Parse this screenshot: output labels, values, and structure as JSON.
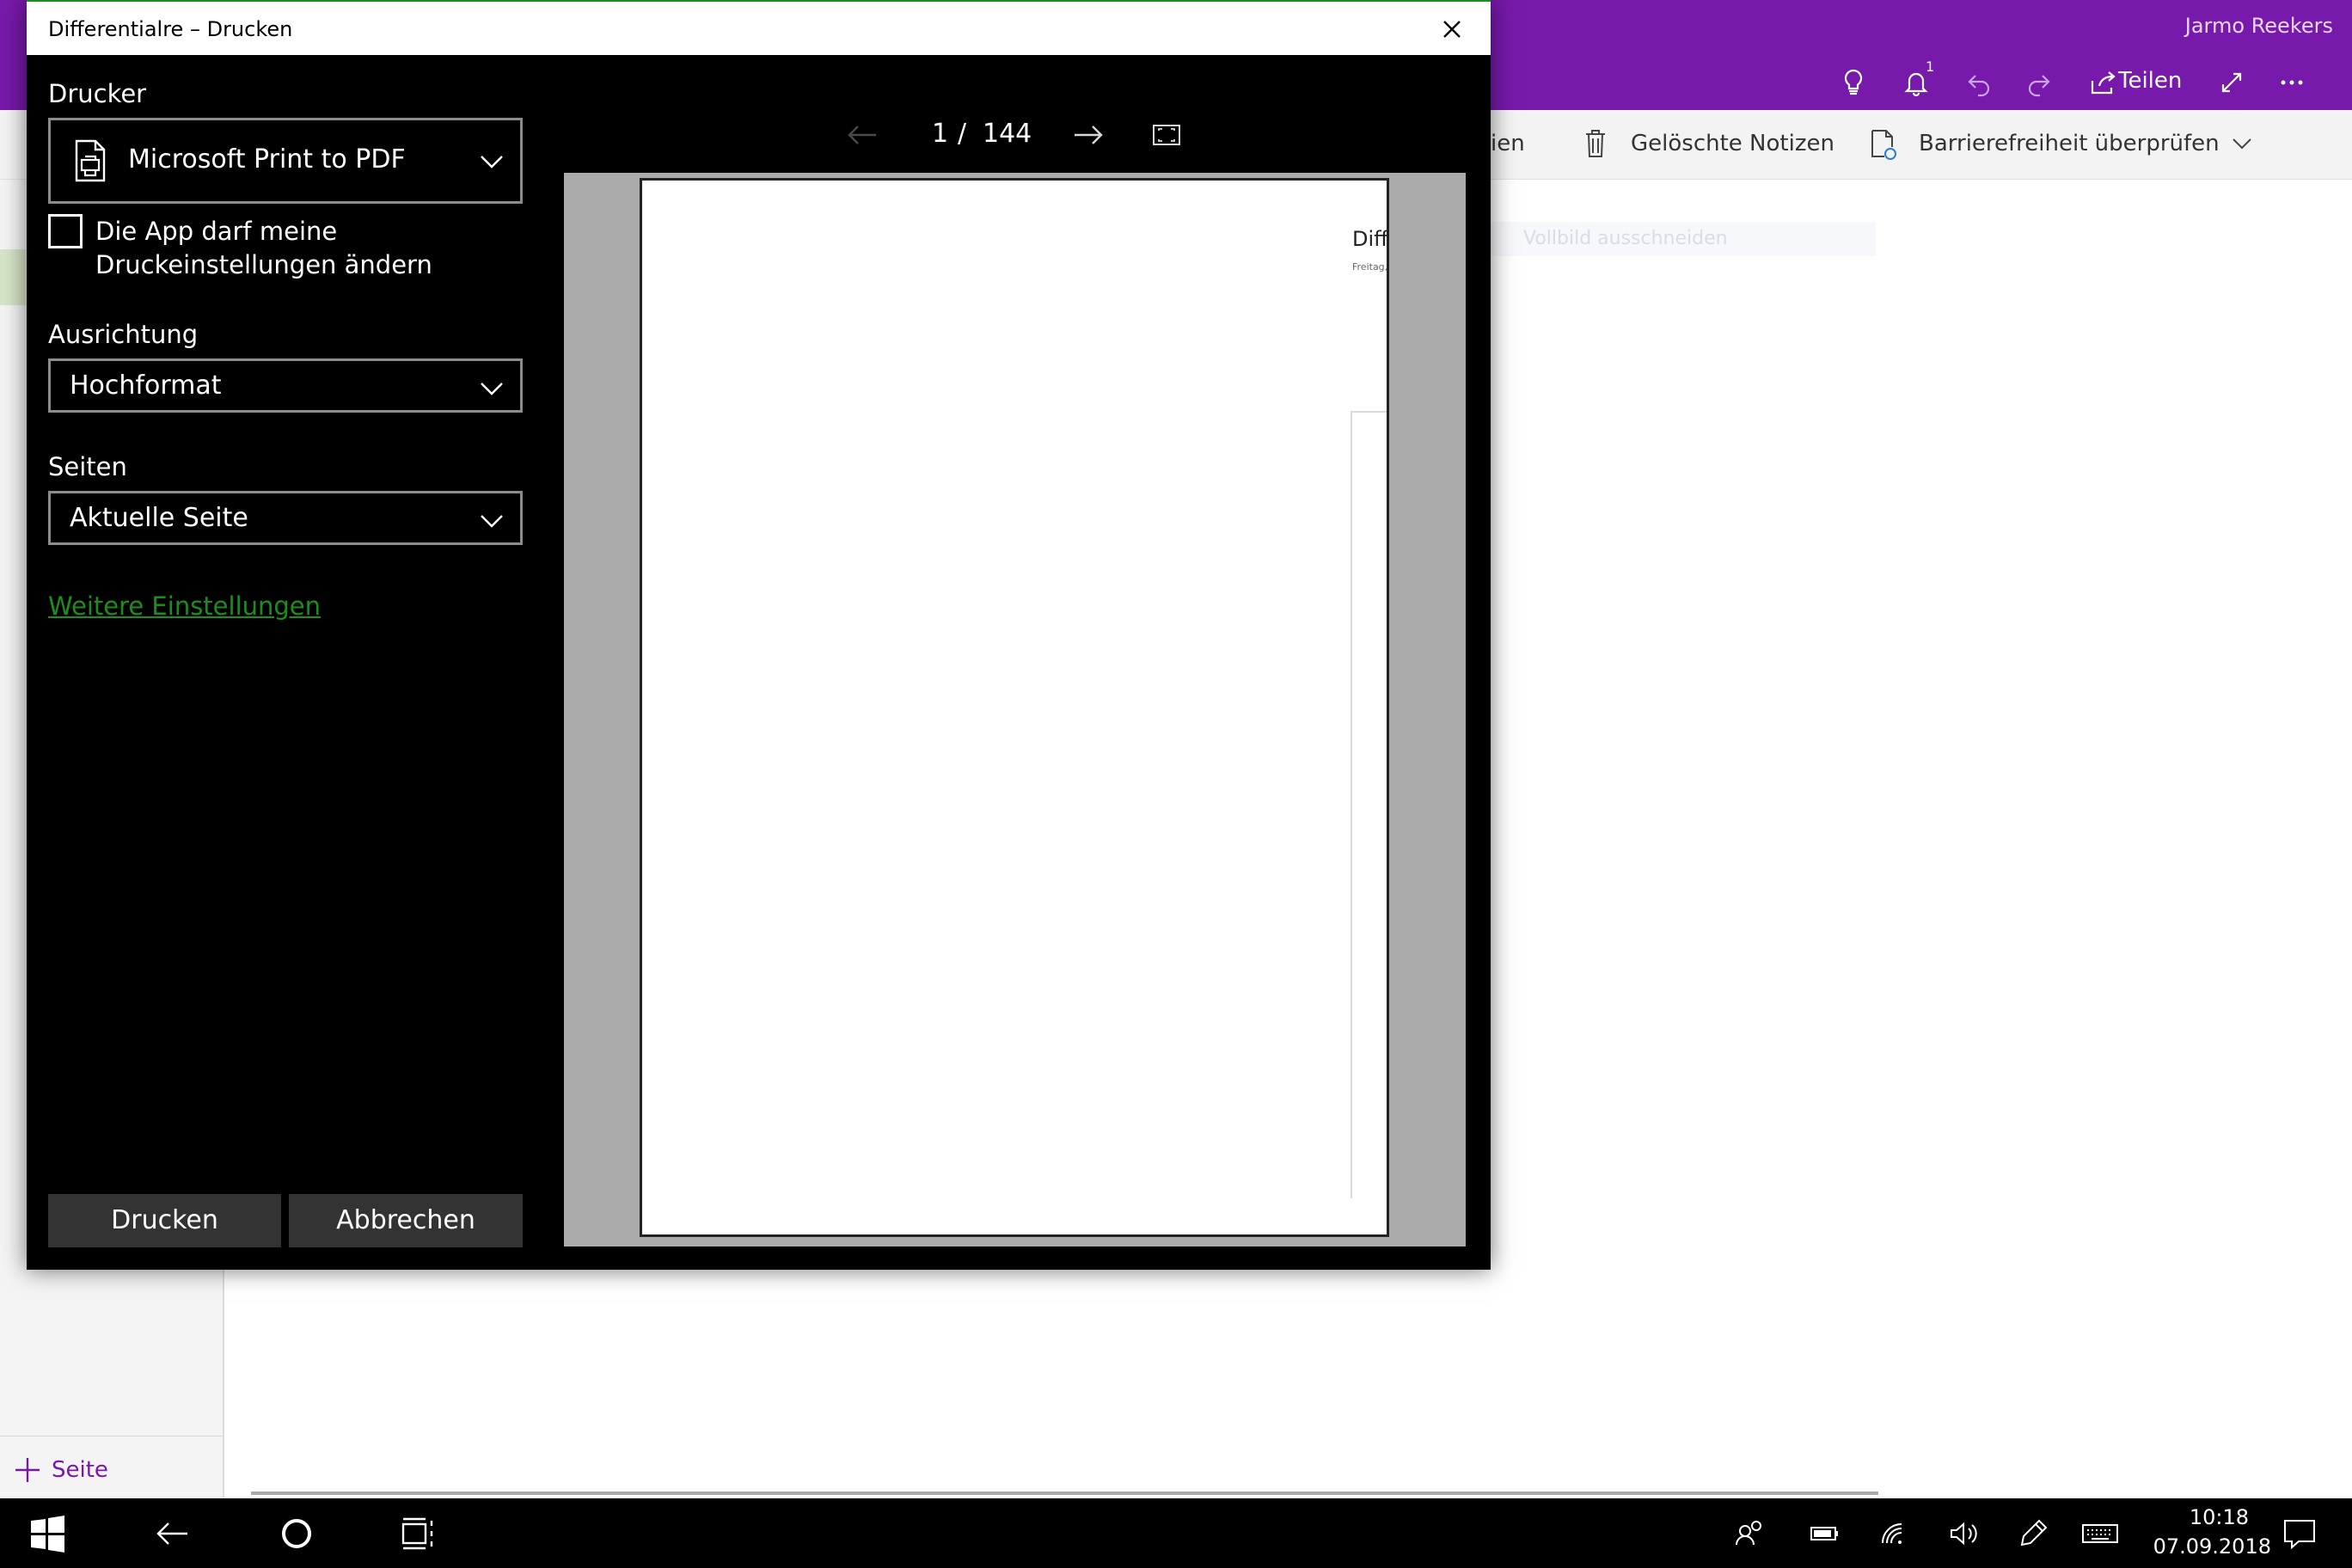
{
  "app": {
    "user_name": "Jarmo Reekers",
    "share_label": "Teilen",
    "notification_count": "1",
    "ribbon": {
      "partial_label": "ien",
      "deleted_notes_label": "Gelöschte Notizen",
      "accessibility_label": "Barrierefreiheit überprüfen"
    },
    "add_page_label": "Seite",
    "canvas_hint": "Vollbild ausschneiden",
    "accent_color": "#7719aa"
  },
  "dialog": {
    "title": "Differentialre – Drucken",
    "printer_label": "Drucker",
    "printer_value": "Microsoft Print to PDF",
    "app_settings_checkbox": "Die App darf meine Druckeinstellungen ändern",
    "app_settings_checked": false,
    "orientation_label": "Ausrichtung",
    "orientation_value": "Hochformat",
    "pages_label": "Seiten",
    "pages_value": "Aktuelle Seite",
    "more_settings_link": "Weitere Einstellungen",
    "print_button": "Drucken",
    "cancel_button": "Abbrechen",
    "link_color": "#1b8e1b",
    "preview": {
      "current_page": "1",
      "separator": "/",
      "total_pages": "144",
      "page_title_fragment": "Diff",
      "page_date_fragment": "Freitag,"
    }
  },
  "taskbar": {
    "time": "10:18",
    "date": "07.09.2018",
    "icons": [
      "windows-start-icon",
      "back-arrow-icon",
      "cortana-icon",
      "task-view-icon",
      "people-icon",
      "battery-icon",
      "wifi-icon",
      "volume-icon",
      "pen-icon",
      "keyboard-icon",
      "action-center-icon"
    ]
  }
}
